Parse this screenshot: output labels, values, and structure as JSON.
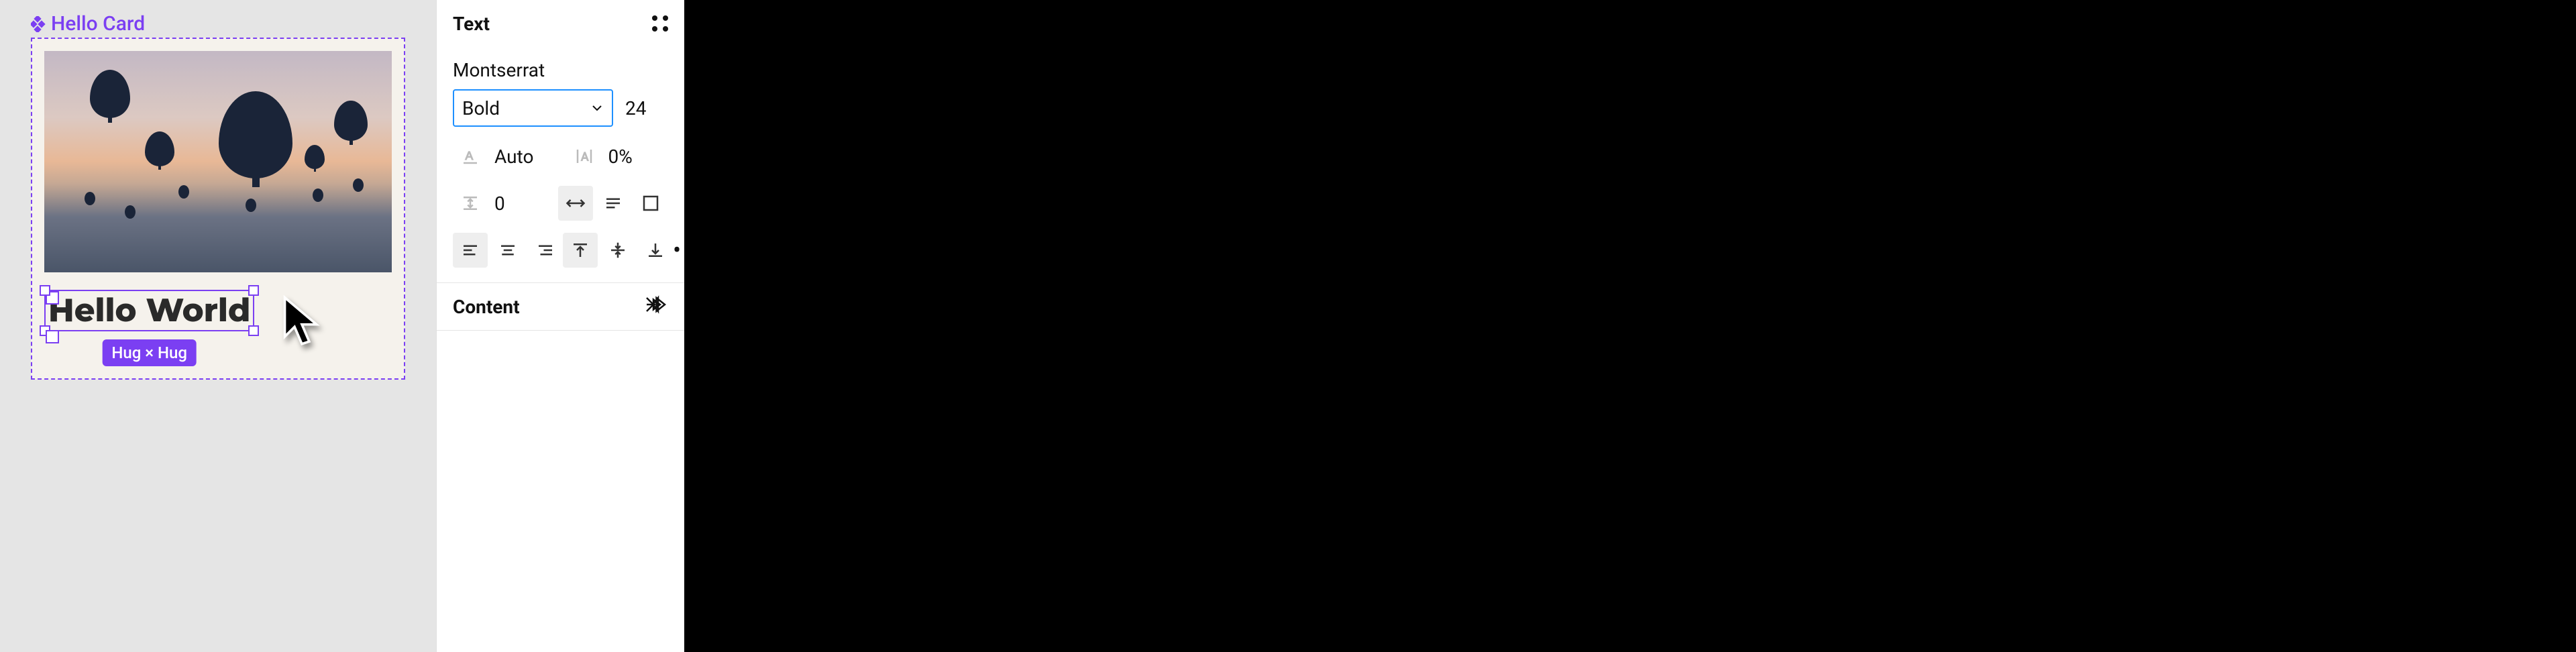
{
  "canvas": {
    "component_name": "Hello Card",
    "selected_text": "Hello World",
    "size_badge": "Hug × Hug"
  },
  "panel": {
    "text_section_title": "Text",
    "font_family": "Montserrat",
    "font_weight": "Bold",
    "font_size": "24",
    "line_height_label": "Auto",
    "letter_spacing": "0%",
    "paragraph_spacing": "0",
    "content_section_title": "Content"
  }
}
